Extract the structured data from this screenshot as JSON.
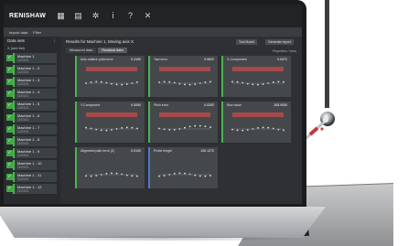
{
  "app": {
    "brand": "RENISHAW",
    "toolbar_buttons": [
      "Import data",
      "Filter"
    ]
  },
  "sidebar": {
    "heading": "Data sets",
    "subheading": "X (see list)",
    "items": [
      {
        "label": "Machine 1",
        "date": "11/03/21"
      },
      {
        "label": "Machine 1 - 2",
        "date": "11/03/21"
      },
      {
        "label": "Machine 1 - 3",
        "date": "11/03/21"
      },
      {
        "label": "Machine 1 - 4",
        "date": "11/03/21"
      },
      {
        "label": "Machine 1 - 5",
        "date": "11/03/21"
      },
      {
        "label": "Machine 1 - 6",
        "date": "11/03/21"
      },
      {
        "label": "Machine 1 - 7",
        "date": "11/03/21"
      },
      {
        "label": "Machine 1 - 8",
        "date": "11/03/21"
      },
      {
        "label": "Machine 1 - 9",
        "date": "11/03/21"
      },
      {
        "label": "Machine 1 - 10",
        "date": "11/03/21"
      },
      {
        "label": "Machine 1 - 11",
        "date": "11/03/21"
      },
      {
        "label": "Machine 1 - 12",
        "date": "11/03/21"
      }
    ]
  },
  "main": {
    "title": "Results for Machine 1, Moving axis X",
    "buttons": [
      "Tool Model",
      "Generate report"
    ],
    "tabs": [
      "Measured data",
      "Residual data"
    ],
    "properties_label": "Properties / tools",
    "cards": [
      {
        "title": "Axis relative point error",
        "value": "0.2190"
      },
      {
        "title": "Yaw error",
        "value": "0.0622"
      },
      {
        "title": "X-Component",
        "value": "0.0471"
      },
      {
        "title": "Y-Component",
        "value": "0.0090"
      },
      {
        "title": "Pitch error",
        "value": "0.0292"
      },
      {
        "title": "Run value",
        "value": "263.0000"
      },
      {
        "title": "Alignment path error (Z)",
        "value": "0.0100"
      },
      {
        "title": "Probe length",
        "value": "100.1272"
      }
    ]
  },
  "colors": {
    "accent_green": "#3ea843",
    "bar_red": "#b84a4a",
    "app_dark": "#2c2e31"
  }
}
